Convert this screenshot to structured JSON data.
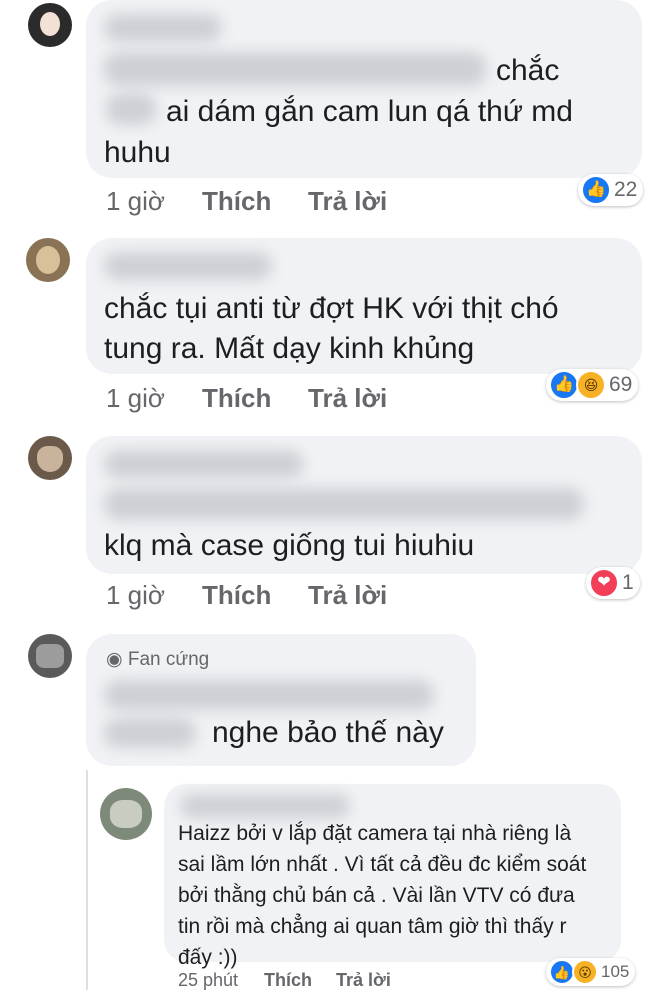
{
  "comments": [
    {
      "text_lines": [
        "chắc",
        "ai dám gắn cam lun qá thứ md",
        "huhu"
      ],
      "time": "1 giờ",
      "like_label": "Thích",
      "reply_label": "Trả lời",
      "reactions": [
        "like"
      ],
      "reaction_count": "22"
    },
    {
      "text_lines": [
        "chắc tụi anti từ đợt HK với thịt chó",
        "tung ra. Mất dạy kinh khủng"
      ],
      "time": "1 giờ",
      "like_label": "Thích",
      "reply_label": "Trả lời",
      "reactions": [
        "like",
        "haha"
      ],
      "reaction_count": "69"
    },
    {
      "text_lines": [
        "klq mà case giống tui hiuhiu"
      ],
      "time": "1 giờ",
      "like_label": "Thích",
      "reply_label": "Trả lời",
      "reactions": [
        "love"
      ],
      "reaction_count": "1"
    },
    {
      "badge": "Fan cứng",
      "text_lines": [
        "nghe bảo thế này"
      ]
    }
  ],
  "reply": {
    "text_lines": [
      "Haizz bởi v lắp đặt camera tại nhà riêng là",
      "sai lầm lớn nhất . Vì tất cả đều đc kiểm soát",
      "bởi thằng chủ bán cả . Vài lần VTV có đưa",
      "tin rồi mà chẳng ai quan tâm giờ thì thấy r",
      "đấy :))"
    ],
    "time": "25 phút",
    "like_label": "Thích",
    "reply_label": "Trả lời",
    "reactions": [
      "like",
      "wow"
    ],
    "reaction_count": "105"
  },
  "colors": {
    "bubble": "#f0f2f5",
    "like": "#1877f2",
    "love": "#f33e58",
    "haha": "#f7b125",
    "meta": "#65676b"
  }
}
